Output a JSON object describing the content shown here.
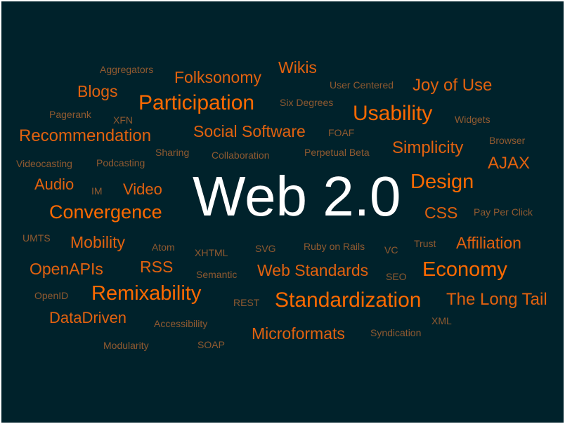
{
  "center": "Web 2.0",
  "colors": {
    "background": "#00222b",
    "center": "#ffffff",
    "strong": "#ff6a00",
    "medium": "#e2620f",
    "weak": "#8f5a30"
  },
  "words": [
    "Aggregators",
    "Folksonomy",
    "Wikis",
    "User Centered",
    "Joy of Use",
    "Blogs",
    "Participation",
    "Six Degrees",
    "Usability",
    "Pagerank",
    "XFN",
    "Widgets",
    "Recommendation",
    "Social Software",
    "FOAF",
    "Browser",
    "Simplicity",
    "Sharing",
    "Collaboration",
    "Perpetual Beta",
    "Videocasting",
    "Podcasting",
    "AJAX",
    "Audio",
    "IM",
    "Video",
    "Design",
    "Convergence",
    "CSS",
    "Pay Per Click",
    "UMTS",
    "Mobility",
    "Atom",
    "XHTML",
    "SVG",
    "Ruby on Rails",
    "VC",
    "Trust",
    "Affiliation",
    "OpenAPIs",
    "RSS",
    "Semantic",
    "Web Standards",
    "SEO",
    "Economy",
    "OpenID",
    "Remixability",
    "REST",
    "Standardization",
    "The Long Tail",
    "DataDriven",
    "Accessibility",
    "XML",
    "Microformats",
    "Syndication",
    "Modularity",
    "SOAP"
  ]
}
